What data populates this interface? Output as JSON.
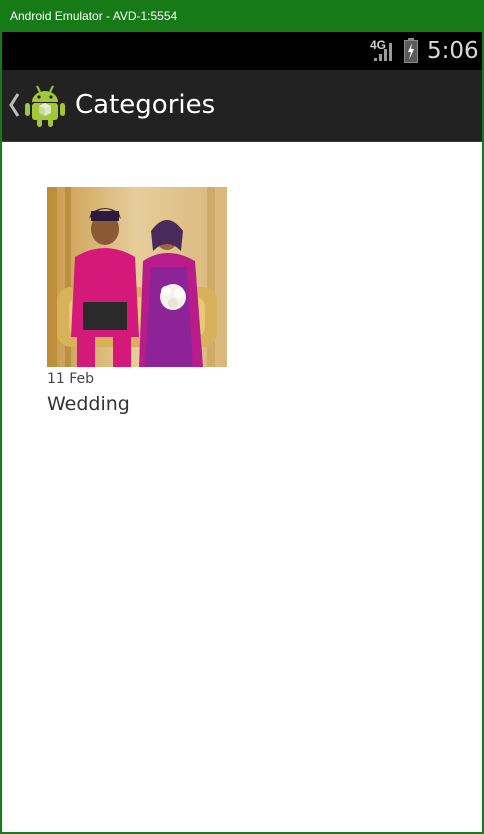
{
  "window": {
    "title": "Android Emulator - AVD-1:5554"
  },
  "status_bar": {
    "network": "4G",
    "time": "5:06",
    "icons": [
      "signal-icon",
      "battery-charging-icon"
    ]
  },
  "action_bar": {
    "title": "Categories",
    "icons": [
      "back-chevron-icon",
      "android-app-icon"
    ]
  },
  "categories": [
    {
      "date": "11 Feb",
      "title": "Wedding",
      "thumbnail_icon": "wedding-photo"
    }
  ],
  "colors": {
    "window_title_bar": "#167a16",
    "status_bar": "#000000",
    "action_bar": "#222222",
    "android_green": "#a4c639"
  }
}
